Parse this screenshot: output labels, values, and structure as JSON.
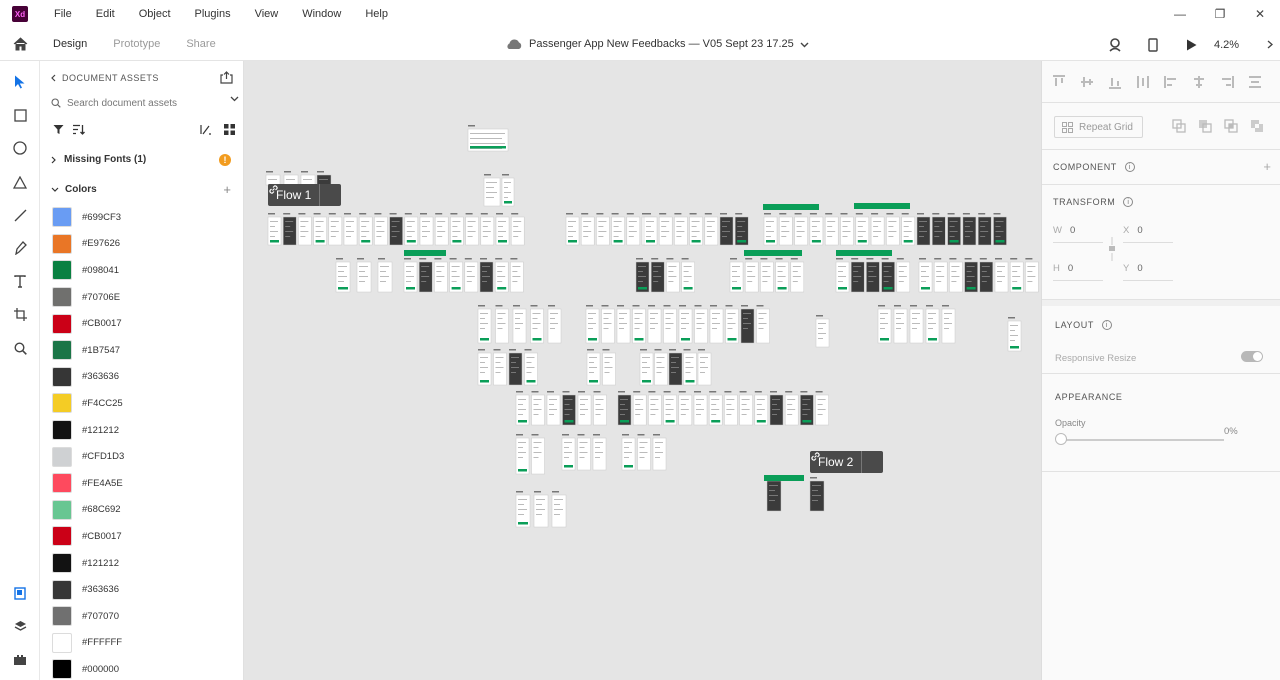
{
  "app": {
    "logo": "Xd"
  },
  "menu": [
    "File",
    "Edit",
    "Object",
    "Plugins",
    "View",
    "Window",
    "Help"
  ],
  "window_controls": [
    "—",
    "❐",
    "✕"
  ],
  "tabs": [
    {
      "label": "Design",
      "active": true
    },
    {
      "label": "Prototype",
      "active": false
    },
    {
      "label": "Share",
      "active": false
    }
  ],
  "document": {
    "title": "Passenger App New Feedbacks  — V05 Sept 23 17.25"
  },
  "zoom": "4.2%",
  "assets": {
    "header": "DOCUMENT ASSETS",
    "search_placeholder": "Search document assets",
    "missing_fonts": "Missing Fonts (1)",
    "missing_badge": "!",
    "colors_label": "Colors",
    "add_symbol": "+",
    "colors": [
      "#699CF3",
      "#E97626",
      "#098041",
      "#70706E",
      "#CB0017",
      "#1B7547",
      "#363636",
      "#F4CC25",
      "#121212",
      "#CFD1D3",
      "#FE4A5E",
      "#68C692",
      "#CB0017",
      "#121212",
      "#363636",
      "#707070",
      "#FFFFFF",
      "#000000"
    ]
  },
  "canvas": {
    "flows": [
      {
        "label": "Flow 1"
      },
      {
        "label": "Flow 2"
      }
    ],
    "accent": "#0a9e58"
  },
  "properties": {
    "repeat_grid": "Repeat Grid",
    "component": "COMPONENT",
    "add": "+",
    "transform": "TRANSFORM",
    "w_label": "W",
    "w_value": "0",
    "x_label": "X",
    "x_value": "0",
    "h_label": "H",
    "h_value": "0",
    "y_label": "Y",
    "y_value": "0",
    "layout": "LAYOUT",
    "responsive_resize": "Responsive Resize",
    "appearance": "APPEARANCE",
    "opacity_label": "Opacity",
    "opacity_value": "0%"
  }
}
